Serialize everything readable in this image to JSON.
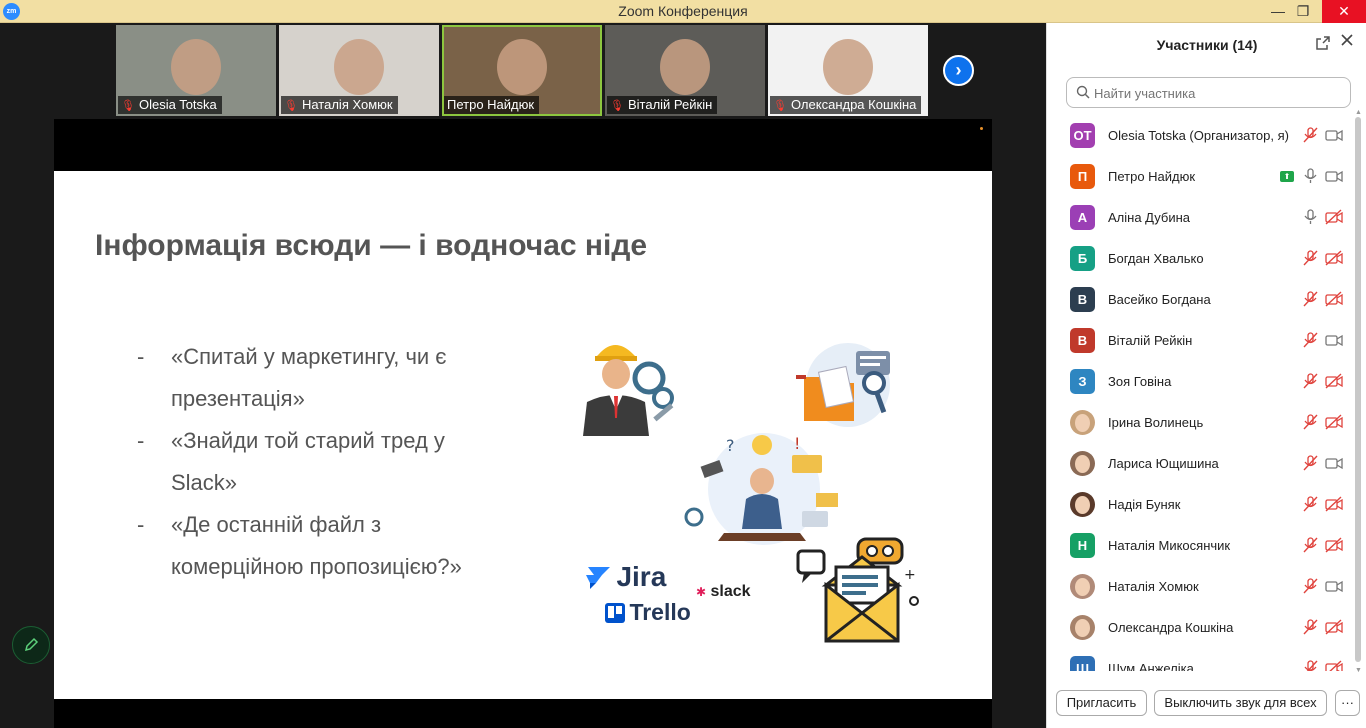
{
  "window": {
    "title": "Zoom Конференция",
    "app_icon_text": "zm",
    "minimize": "—",
    "maximize": "❐",
    "close": "✕"
  },
  "video_strip": [
    {
      "name": "Olesia Totska",
      "muted": true,
      "active": false
    },
    {
      "name": "Наталія Хомюк",
      "muted": true,
      "active": false
    },
    {
      "name": "Петро Найдюк",
      "muted": false,
      "active": true
    },
    {
      "name": "Віталій Рейкін",
      "muted": true,
      "active": false
    },
    {
      "name": "Олександра Кошкіна",
      "muted": true,
      "active": false
    }
  ],
  "slide": {
    "title": "Інформація всюди — і водночас ніде",
    "bullets": [
      {
        "dash": "-",
        "text": "«Спитай у маркетингу, чи є презентація»"
      },
      {
        "dash": "-",
        "text": "«Знайди той старий тред у Slack»"
      },
      {
        "dash": "-",
        "text": "«Де останній файл з комерційною пропозицією?»"
      }
    ],
    "logos": {
      "jira": "Jira",
      "slack": "slack",
      "trello": "Trello"
    }
  },
  "panel": {
    "title": "Участники (14)",
    "search_placeholder": "Найти участника",
    "invite_label": "Пригласить",
    "mute_all_label": "Выключить звук для всех",
    "more_label": "···"
  },
  "participants": [
    {
      "initials": "ОТ",
      "color": "#a23fb0",
      "photo": false,
      "name": "Olesia Totska (Организатор, я)",
      "mic": "off",
      "video": "on",
      "sharing": false
    },
    {
      "initials": "П",
      "color": "#e8590c",
      "photo": false,
      "name": "Петро Найдюк",
      "mic": "on",
      "video": "on",
      "sharing": true
    },
    {
      "initials": "А",
      "color": "#9b3fb5",
      "photo": false,
      "name": "Аліна Дубина",
      "mic": "on",
      "video": "off",
      "sharing": false
    },
    {
      "initials": "Б",
      "color": "#16a085",
      "photo": false,
      "name": "Богдан Хвалько",
      "mic": "off",
      "video": "off",
      "sharing": false
    },
    {
      "initials": "В",
      "color": "#2c3e50",
      "photo": false,
      "name": "Васейко Богдана",
      "mic": "off",
      "video": "off",
      "sharing": false
    },
    {
      "initials": "В",
      "color": "#c0392b",
      "photo": false,
      "name": "Віталій Рейкін",
      "mic": "off",
      "video": "on",
      "sharing": false
    },
    {
      "initials": "З",
      "color": "#2e86c1",
      "photo": false,
      "name": "Зоя Говіна",
      "mic": "off",
      "video": "off",
      "sharing": false
    },
    {
      "initials": "",
      "color": "#c8a27a",
      "photo": true,
      "name": "Ірина Волинець",
      "mic": "off",
      "video": "off",
      "sharing": false
    },
    {
      "initials": "",
      "color": "#8a6a55",
      "photo": true,
      "name": "Лариса Ющишина",
      "mic": "off",
      "video": "on",
      "sharing": false
    },
    {
      "initials": "",
      "color": "#5a3a2a",
      "photo": true,
      "name": "Надія Буняк",
      "mic": "off",
      "video": "off",
      "sharing": false
    },
    {
      "initials": "Н",
      "color": "#16a065",
      "photo": false,
      "name": "Наталія Микосянчик",
      "mic": "off",
      "video": "off",
      "sharing": false
    },
    {
      "initials": "",
      "color": "#b08a78",
      "photo": true,
      "name": "Наталія Хомюк",
      "mic": "off",
      "video": "on",
      "sharing": false
    },
    {
      "initials": "",
      "color": "#a7826a",
      "photo": true,
      "name": "Олександра Кошкіна",
      "mic": "off",
      "video": "off",
      "sharing": false
    },
    {
      "initials": "Ш",
      "color": "#2e6fb5",
      "photo": false,
      "name": "Шум Анжеліка",
      "mic": "off",
      "video": "off",
      "sharing": false
    }
  ]
}
